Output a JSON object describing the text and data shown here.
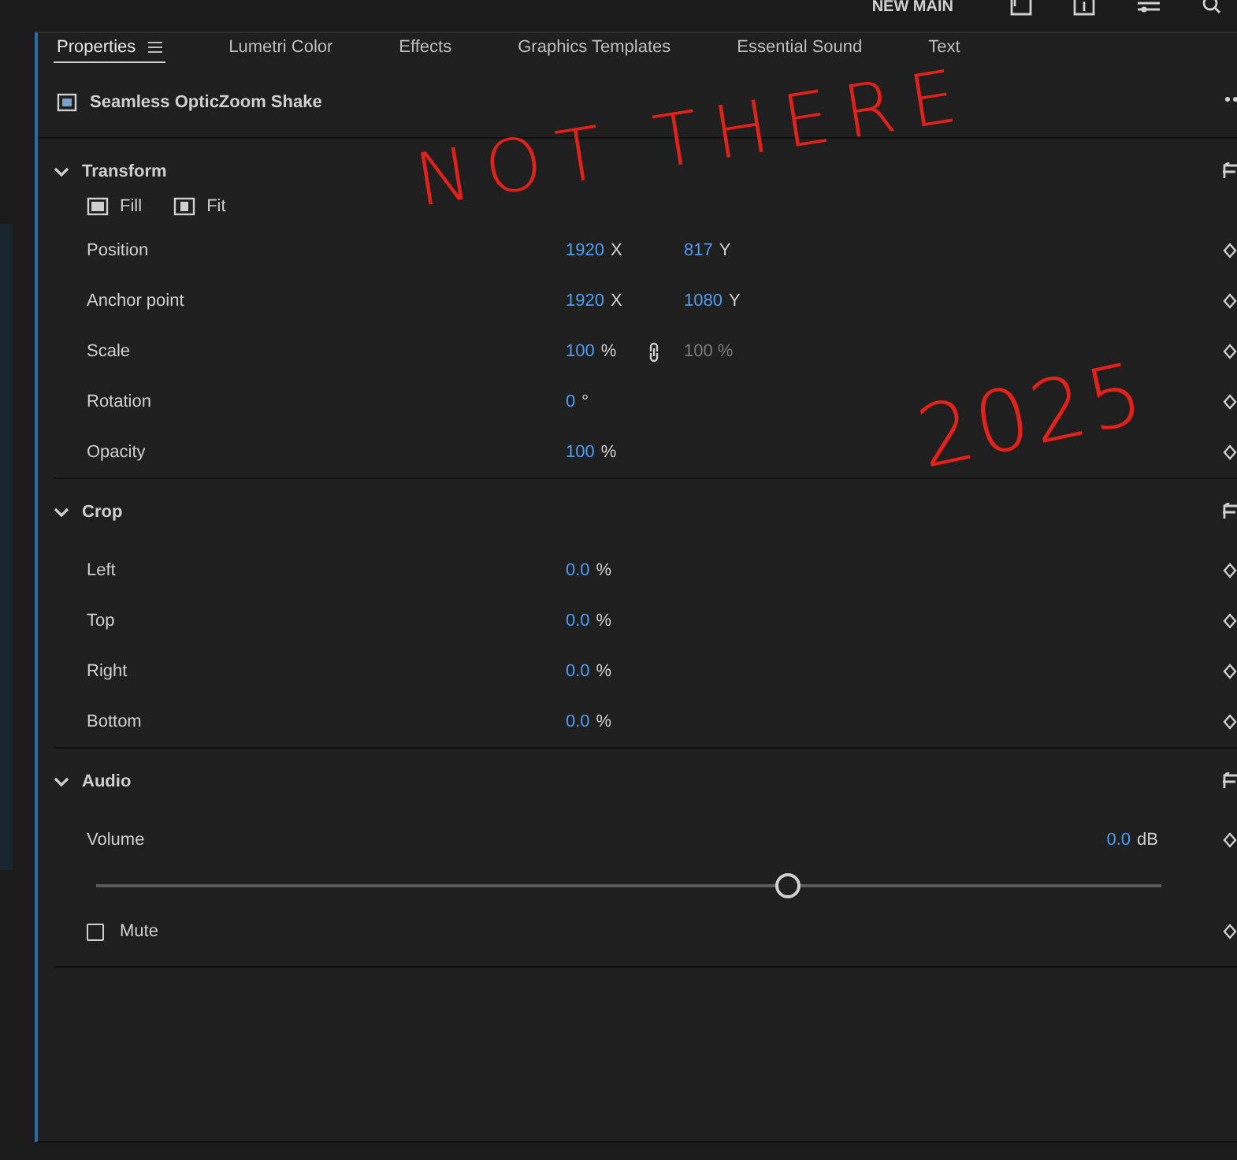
{
  "top_bar": {
    "workspace": "NEW MAIN"
  },
  "tabs": [
    {
      "label": "Properties",
      "selected": true,
      "menu": true
    },
    {
      "label": "Lumetri Color",
      "selected": false,
      "menu": false
    },
    {
      "label": "Effects",
      "selected": false,
      "menu": false
    },
    {
      "label": "Graphics Templates",
      "selected": false,
      "menu": false
    },
    {
      "label": "Essential Sound",
      "selected": false,
      "menu": false
    },
    {
      "label": "Text",
      "selected": false,
      "menu": false
    }
  ],
  "clip": {
    "name": "Seamless OpticZoom Shake"
  },
  "sections": [
    {
      "title": "Transform",
      "expanded": true,
      "fit_buttons": [
        "Fill",
        "Fit"
      ],
      "rows": [
        {
          "kind": "values",
          "label": "Position",
          "link": false,
          "values": [
            {
              "value": "1920",
              "unit": "X",
              "dimmed": false
            },
            {
              "value": "817",
              "unit": "Y",
              "dimmed": false
            }
          ]
        },
        {
          "kind": "values",
          "label": "Anchor point",
          "link": false,
          "values": [
            {
              "value": "1920",
              "unit": "X",
              "dimmed": false
            },
            {
              "value": "1080",
              "unit": "Y",
              "dimmed": false
            }
          ]
        },
        {
          "kind": "values",
          "label": "Scale",
          "link": true,
          "values": [
            {
              "value": "100",
              "unit": "%",
              "dimmed": false
            },
            {
              "value": "100 %",
              "dimmed": true
            }
          ]
        },
        {
          "kind": "values",
          "label": "Rotation",
          "link": false,
          "values": [
            {
              "value": "0",
              "unit": "°",
              "dimmed": false
            }
          ]
        },
        {
          "kind": "values",
          "label": "Opacity",
          "link": false,
          "values": [
            {
              "value": "100",
              "unit": "%",
              "dimmed": false
            }
          ]
        }
      ]
    },
    {
      "title": "Crop",
      "expanded": true,
      "rows": [
        {
          "kind": "values",
          "label": "Left",
          "link": false,
          "values": [
            {
              "value": "0.0",
              "unit": "%",
              "dimmed": false
            }
          ]
        },
        {
          "kind": "values",
          "label": "Top",
          "link": false,
          "values": [
            {
              "value": "0.0",
              "unit": "%",
              "dimmed": false
            }
          ]
        },
        {
          "kind": "values",
          "label": "Right",
          "link": false,
          "values": [
            {
              "value": "0.0",
              "unit": "%",
              "dimmed": false
            }
          ]
        },
        {
          "kind": "values",
          "label": "Bottom",
          "link": false,
          "values": [
            {
              "value": "0.0",
              "unit": "%",
              "dimmed": false
            }
          ]
        }
      ]
    },
    {
      "title": "Audio",
      "expanded": true,
      "rows": [
        {
          "kind": "slider",
          "label": "Volume",
          "reading": "0.0",
          "unit": "dB",
          "level": 0.65
        },
        {
          "kind": "checkbox",
          "label": "Mute",
          "checked": false
        }
      ]
    }
  ],
  "annotations": [
    {
      "text": "NOT THERE",
      "color": "#e3211b"
    },
    {
      "text": "2025",
      "color": "#e3211b"
    }
  ]
}
